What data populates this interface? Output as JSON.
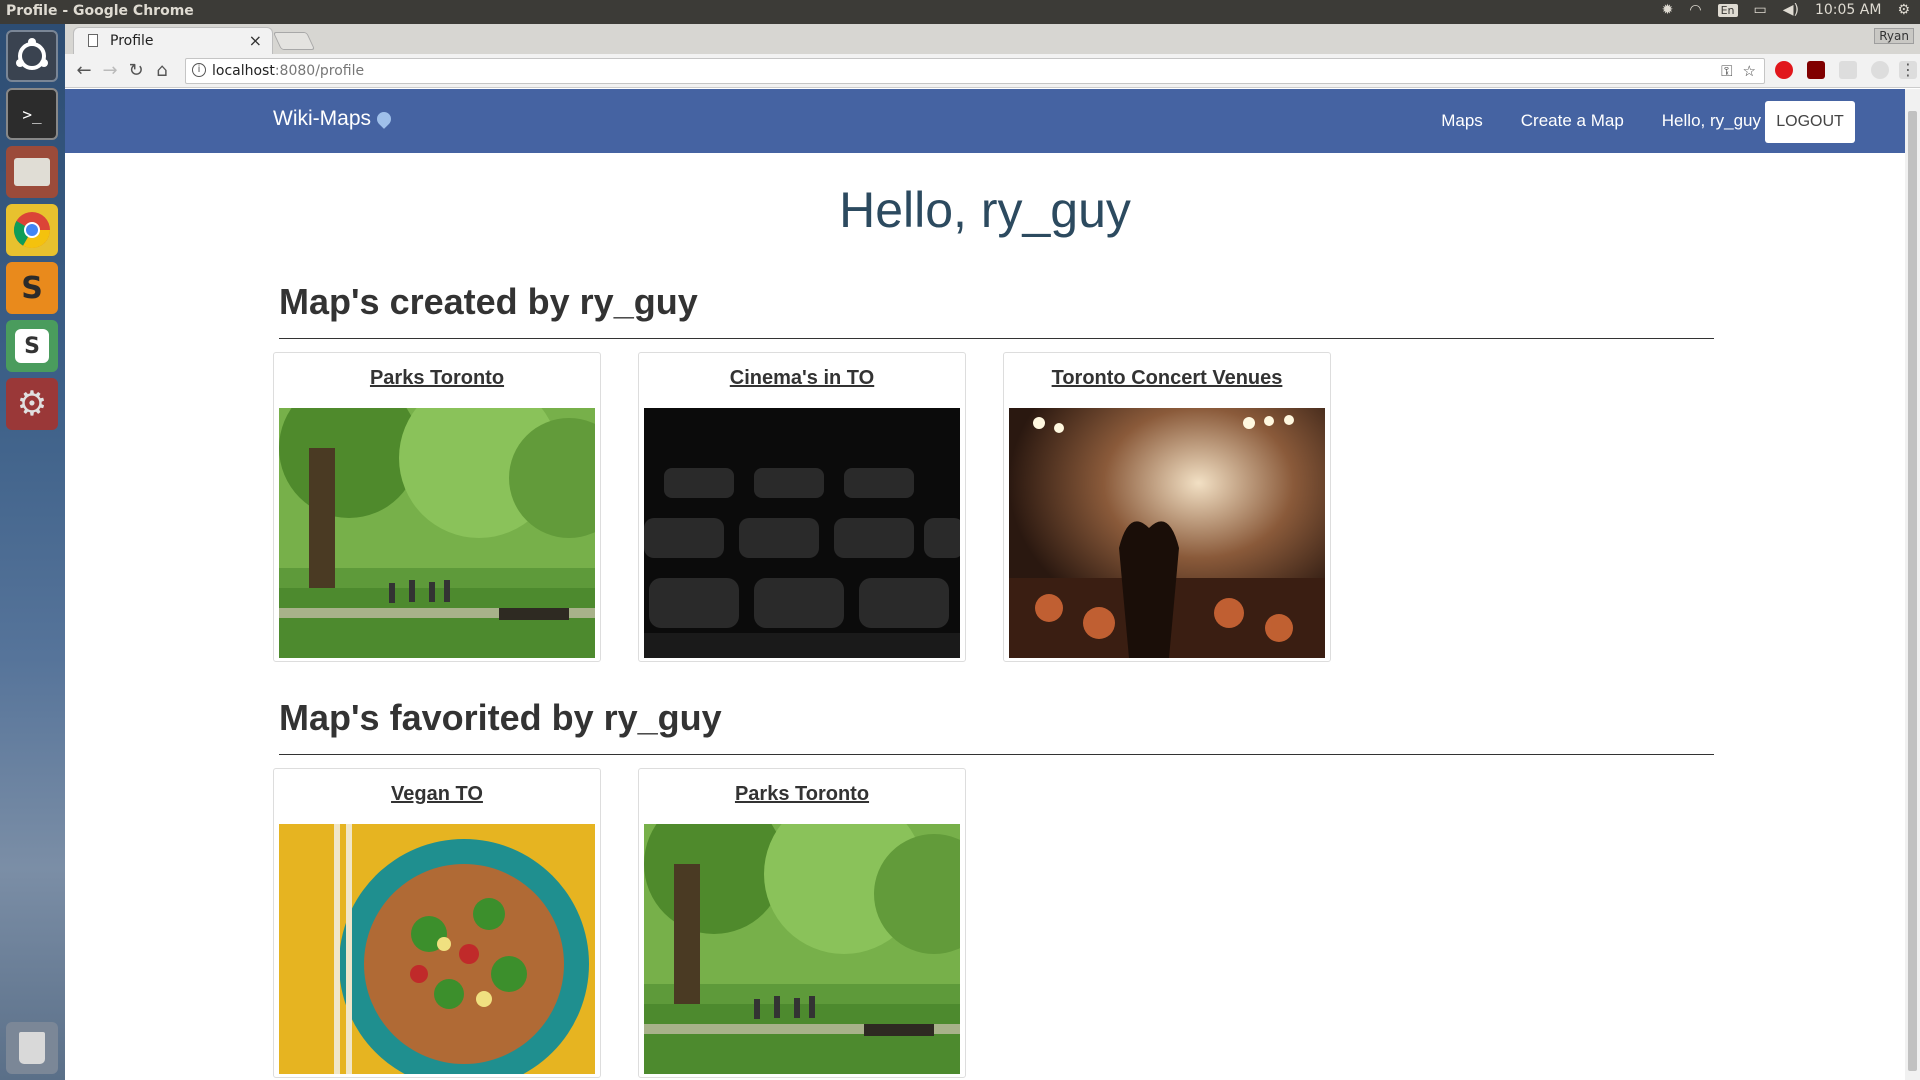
{
  "os": {
    "window_title": "Profile - Google Chrome",
    "keyboard_layout": "En",
    "clock": "10:05 AM",
    "launcher_icons": [
      "ubuntu-icon",
      "terminal-icon",
      "files-icon",
      "chrome-icon",
      "sublime-icon",
      "slack-icon",
      "settings-icon",
      "trash-icon"
    ]
  },
  "browser": {
    "tab_label": "Profile",
    "user_chip": "Ryan",
    "url_host": "localhost",
    "url_path": ":8080/profile"
  },
  "navbar": {
    "brand": "Wiki-Maps",
    "links": [
      "Maps",
      "Create a Map",
      "Hello, ry_guy"
    ],
    "logout": "LOGOUT",
    "color": "#4563a2"
  },
  "page": {
    "greeting": "Hello, ry_guy",
    "created_heading": "Map's created by ry_guy",
    "favorited_heading": "Map's favorited by ry_guy",
    "created_maps": [
      {
        "title": "Parks Toronto",
        "image": "park"
      },
      {
        "title": "Cinema's in TO",
        "image": "cinema"
      },
      {
        "title": "Toronto Concert Venues",
        "image": "concert"
      }
    ],
    "favorited_maps": [
      {
        "title": "Vegan TO",
        "image": "food"
      },
      {
        "title": "Parks Toronto",
        "image": "park"
      }
    ]
  }
}
